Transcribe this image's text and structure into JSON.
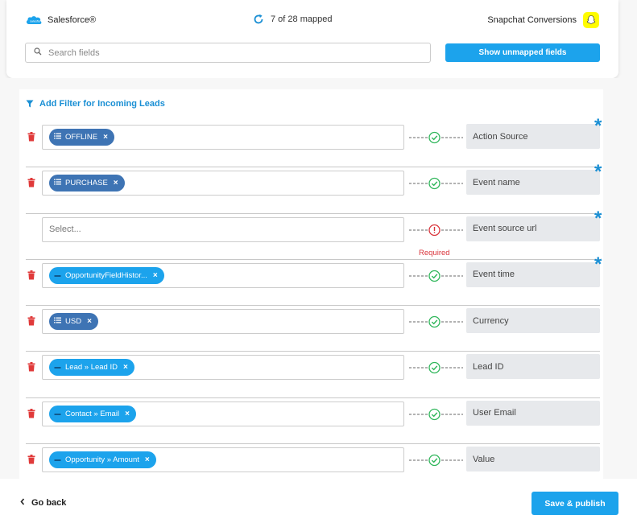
{
  "header": {
    "source_name": "Salesforce®",
    "mapped_status": "7 of 28 mapped",
    "destination_name": "Snapchat Conversions",
    "search_placeholder": "Search fields",
    "show_unmapped_label": "Show unmapped fields"
  },
  "filter": {
    "label": "Add Filter for Incoming Leads"
  },
  "rows": [
    {
      "tag": "OFFLINE",
      "tag_kind": "list",
      "destination": "Action Source",
      "required": true,
      "status": "ok"
    },
    {
      "tag": "PURCHASE",
      "tag_kind": "list",
      "destination": "Event name",
      "required": true,
      "status": "ok"
    },
    {
      "placeholder": "Select...",
      "destination": "Event source url",
      "required": true,
      "status": "error",
      "status_label": "Required"
    },
    {
      "tag": "OpportunityFieldHistor...",
      "tag_kind": "field",
      "destination": "Event time",
      "required": true,
      "status": "ok"
    },
    {
      "tag": "USD",
      "tag_kind": "list",
      "destination": "Currency",
      "required": false,
      "status": "ok"
    },
    {
      "tag": "Lead » Lead ID",
      "tag_kind": "field",
      "destination": "Lead ID",
      "required": false,
      "status": "ok"
    },
    {
      "tag": "Contact » Email",
      "tag_kind": "field",
      "destination": "User Email",
      "required": false,
      "status": "ok"
    },
    {
      "tag": "Opportunity » Amount",
      "tag_kind": "field",
      "destination": "Value",
      "required": false,
      "status": "ok"
    }
  ],
  "required_marker": "*",
  "footer": {
    "back_label": "Go back",
    "save_label": "Save & publish"
  },
  "colors": {
    "accent": "#1ca3ec",
    "link": "#1a8fd4",
    "tag_list": "#3e74b4",
    "ok": "#2fb65a",
    "error": "#d9343b",
    "delete": "#e03a3a",
    "snapchat": "#fffc00"
  }
}
